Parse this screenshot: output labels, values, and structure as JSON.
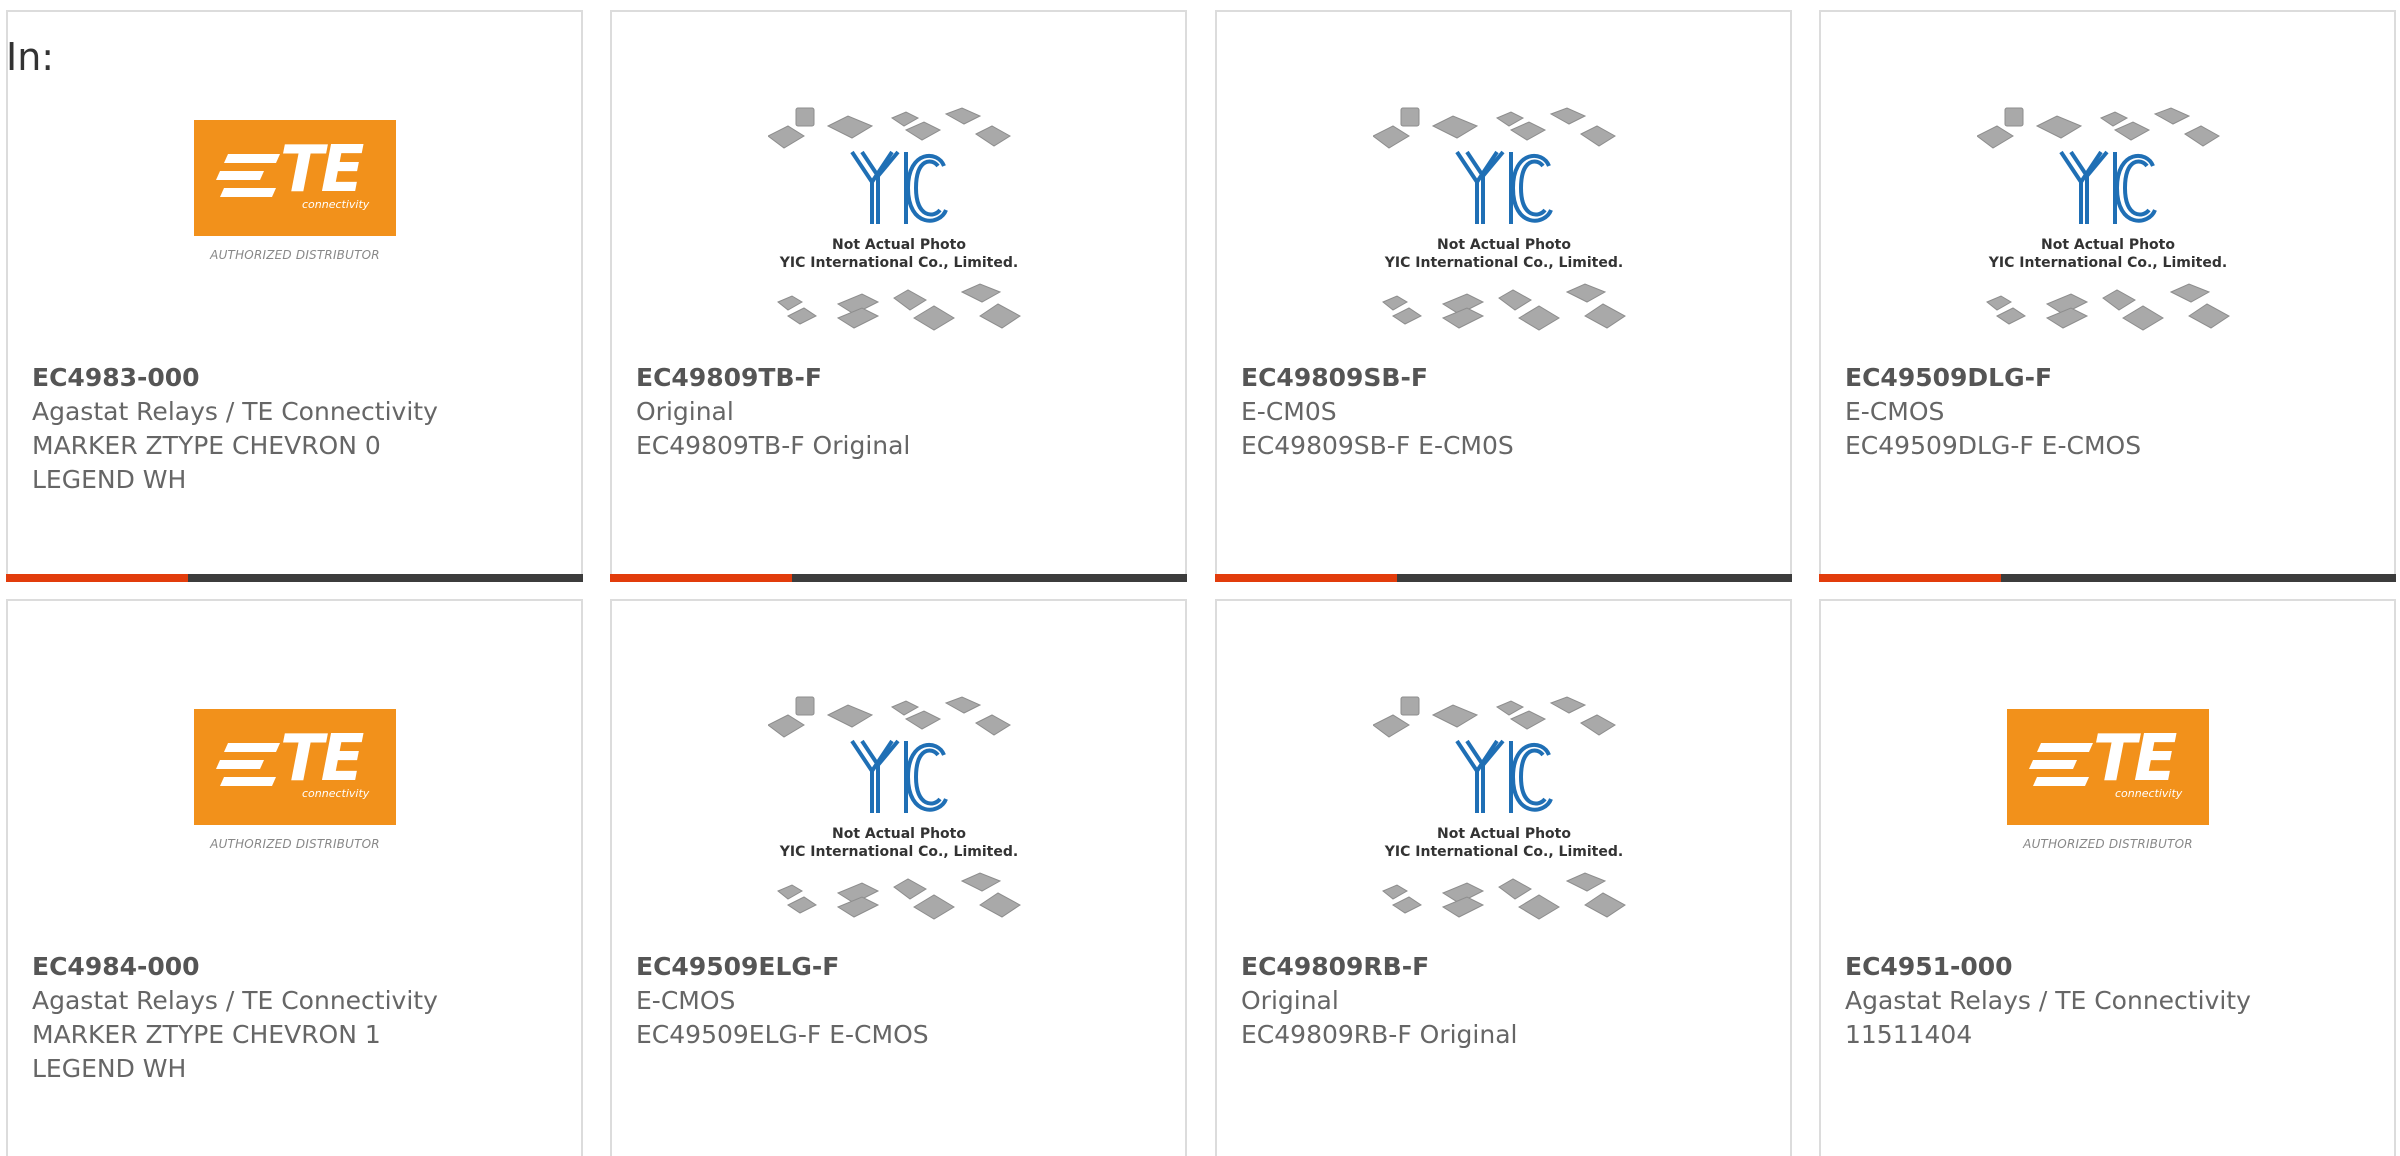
{
  "header": {
    "in_label": "In:"
  },
  "logo_text": {
    "te_letters": "TE",
    "te_connectivity": "connectivity",
    "te_authorized": "AUTHORIZED DISTRIBUTOR",
    "yic_line1": "Not Actual Photo",
    "yic_line2": "YIC International Co., Limited."
  },
  "colors": {
    "accent": "#e23c0c",
    "bar_dark": "#3c3c3c",
    "te_orange": "#f2911b",
    "yic_blue": "#1f6fb5"
  },
  "products": [
    {
      "image": "te-logo",
      "part_number": "EC4983-000",
      "line1": "Agastat Relays / TE Connectivity",
      "line2": "MARKER ZTYPE CHEVRON 0",
      "line3": "LEGEND WH"
    },
    {
      "image": "yic-placeholder",
      "part_number": "EC49809TB-F",
      "line1": "Original",
      "line2": "EC49809TB-F Original",
      "line3": ""
    },
    {
      "image": "yic-placeholder",
      "part_number": "EC49809SB-F",
      "line1": "E-CM0S",
      "line2": "EC49809SB-F E-CM0S",
      "line3": ""
    },
    {
      "image": "yic-placeholder",
      "part_number": "EC49509DLG-F",
      "line1": "E-CMOS",
      "line2": "EC49509DLG-F E-CMOS",
      "line3": ""
    },
    {
      "image": "te-logo",
      "part_number": "EC4984-000",
      "line1": "Agastat Relays / TE Connectivity",
      "line2": "MARKER ZTYPE CHEVRON 1",
      "line3": "LEGEND WH"
    },
    {
      "image": "yic-placeholder",
      "part_number": "EC49509ELG-F",
      "line1": "E-CMOS",
      "line2": "EC49509ELG-F E-CMOS",
      "line3": ""
    },
    {
      "image": "yic-placeholder",
      "part_number": "EC49809RB-F",
      "line1": "Original",
      "line2": "EC49809RB-F Original",
      "line3": ""
    },
    {
      "image": "te-logo",
      "part_number": "EC4951-000",
      "line1": "Agastat Relays / TE Connectivity",
      "line2": "11511404",
      "line3": ""
    }
  ]
}
